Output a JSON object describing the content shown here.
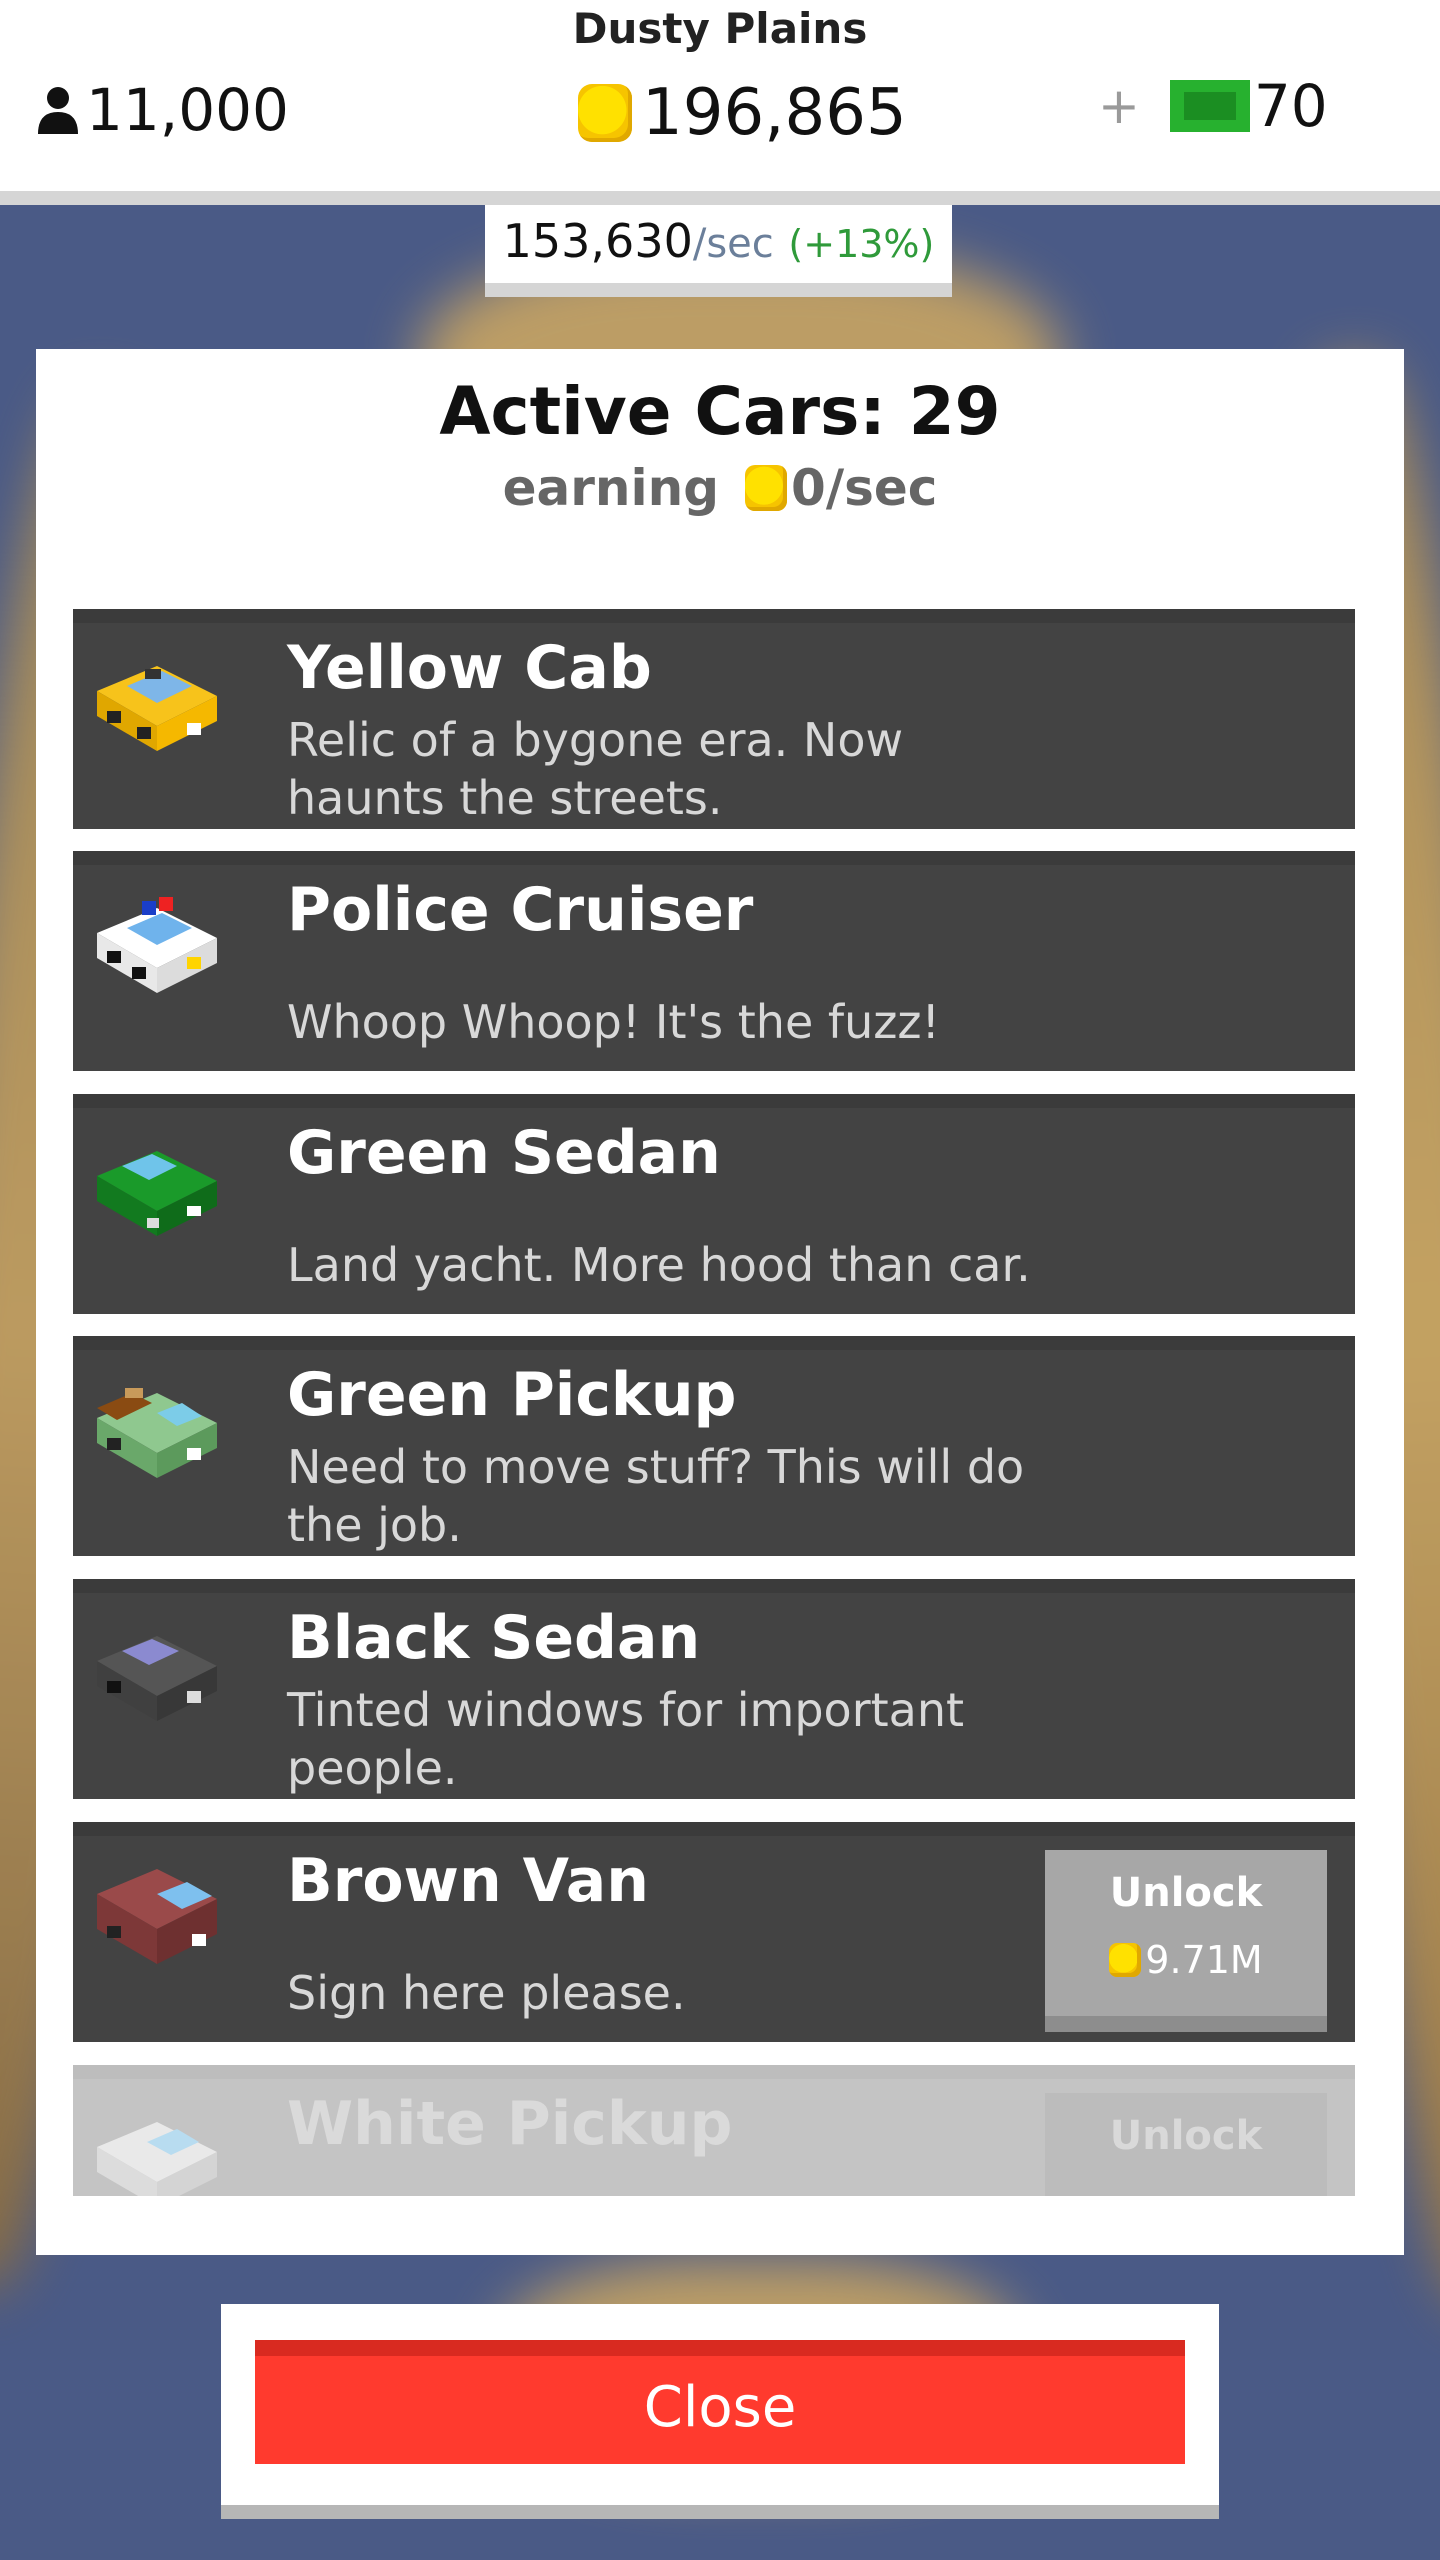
{
  "header": {
    "region_name": "Dusty Plains",
    "population": "11,000",
    "coins": "196,865",
    "cash": "70",
    "plus_symbol": "+",
    "rate_value": "153,630",
    "rate_unit": "/sec",
    "rate_bonus": "(+13%)"
  },
  "panel": {
    "title": "Active Cars: 29",
    "earning_label": "earning",
    "earning_value": "0/sec"
  },
  "cars": [
    {
      "name": "Yellow Cab",
      "description": "Relic of a bygone era. Now haunts the streets.",
      "icon": "yellow-cab-icon"
    },
    {
      "name": "Police Cruiser",
      "description": "Whoop Whoop! It's the fuzz!",
      "icon": "police-cruiser-icon"
    },
    {
      "name": "Green Sedan",
      "description": "Land yacht. More hood than car.",
      "icon": "green-sedan-icon"
    },
    {
      "name": "Green Pickup",
      "description": "Need to move stuff? This will do the job.",
      "icon": "green-pickup-icon"
    },
    {
      "name": "Black Sedan",
      "description": "Tinted windows for important people.",
      "icon": "black-sedan-icon"
    },
    {
      "name": "Brown Van",
      "description": "Sign here please.",
      "icon": "brown-van-icon",
      "unlock_label": "Unlock",
      "unlock_price": "9.71M"
    },
    {
      "name": "White Pickup",
      "description": "",
      "icon": "white-pickup-icon",
      "unlock_label": "Unlock"
    }
  ],
  "close_label": "Close",
  "colors": {
    "close_button": "#ff3a2e",
    "card_bg": "#434343",
    "unlock_button": "#a7a7a7",
    "coin": "#ffd400",
    "rate_bonus": "#2f9a3a"
  }
}
